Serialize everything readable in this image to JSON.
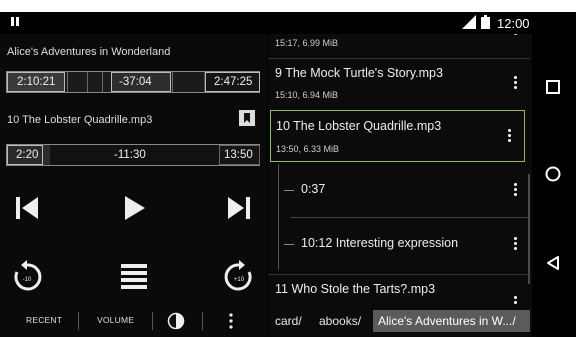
{
  "status": {
    "time": "12:00"
  },
  "book": {
    "title": "Alice's Adventures in Wonderland",
    "elapsed": "2:10:21",
    "remaining": "-37:04",
    "total": "2:47:25",
    "progress_fraction": 0.78
  },
  "track": {
    "title": "10 The Lobster Quadrille.mp3",
    "elapsed": "2:20",
    "remaining": "-11:30",
    "total": "13:50",
    "progress_fraction": 0.17
  },
  "controls": {
    "rewind_label": "-10",
    "forward_label": "+10"
  },
  "bottom_bar": {
    "recent": "RECENT",
    "volume": "VOLUME"
  },
  "files": [
    {
      "title": "",
      "info": "15:17, 6.99 MiB"
    },
    {
      "title": "9 The Mock Turtle's Story.mp3",
      "info": "15:10, 6.94 MiB"
    },
    {
      "title": "10 The Lobster Quadrille.mp3",
      "info": "13:50, 6.33 MiB"
    },
    {
      "title": "11 Who Stole the Tarts?.mp3",
      "info": ""
    }
  ],
  "bookmarks": [
    {
      "label": "0:37"
    },
    {
      "label": "10:12 Interesting expression"
    }
  ],
  "breadcrumbs": [
    "card/",
    "abooks/",
    "Alice's Adventures in W.../"
  ],
  "colors": {
    "accent": "#8bc34a",
    "background": "#000000"
  }
}
